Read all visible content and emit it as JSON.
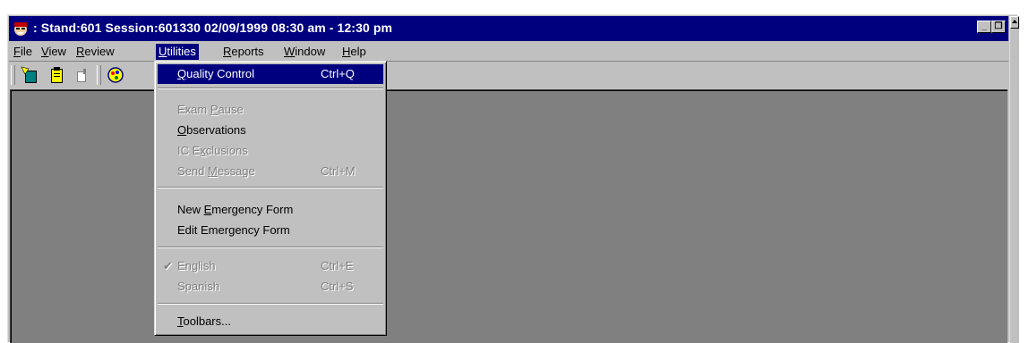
{
  "window": {
    "title": ": Stand:601 Session:601330 02/09/1999 08:30 am - 12:30 pm",
    "controls": {
      "minimize": "_",
      "restore": "❐"
    }
  },
  "menubar": [
    {
      "pre": "",
      "u": "F",
      "post": "ile"
    },
    {
      "pre": "",
      "u": "V",
      "post": "iew"
    },
    {
      "pre": "",
      "u": "R",
      "post": "eview"
    },
    {
      "pre": "",
      "u": "U",
      "post": "tilities"
    },
    {
      "pre": "",
      "u": "R",
      "post": "eports"
    },
    {
      "pre": "",
      "u": "W",
      "post": "indow"
    },
    {
      "pre": "",
      "u": "H",
      "post": "elp"
    }
  ],
  "toolbar": {
    "icons": [
      "new-exam-icon",
      "clipboard-icon",
      "exit-door-icon",
      "palette-icon"
    ]
  },
  "utilities_menu": {
    "items": [
      {
        "pre": "",
        "u": "Q",
        "post": "uality Control",
        "shortcut": "Ctrl+Q",
        "state": "selected"
      },
      {
        "pre": "Exam ",
        "u": "P",
        "post": "ause",
        "shortcut": "",
        "state": "disabled"
      },
      {
        "pre": "",
        "u": "O",
        "post": "bservations",
        "shortcut": "",
        "state": "enabled"
      },
      {
        "pre": "IC E",
        "u": "x",
        "post": "clusions",
        "shortcut": "",
        "state": "disabled"
      },
      {
        "pre": "Send ",
        "u": "M",
        "post": "essage",
        "shortcut": "Ctrl+M",
        "state": "disabled"
      },
      {
        "pre": "New ",
        "u": "E",
        "post": "mergency Form",
        "shortcut": "",
        "state": "enabled"
      },
      {
        "pre": "Edit Emer",
        "u": "g",
        "post": "ency Form",
        "shortcut": "",
        "state": "enabled"
      },
      {
        "pre": "English",
        "u": "",
        "post": "",
        "shortcut": "Ctrl+E",
        "state": "disabled",
        "checked": "✔"
      },
      {
        "pre": "Spanish",
        "u": "",
        "post": "",
        "shortcut": "Ctrl+S",
        "state": "disabled"
      },
      {
        "pre": "",
        "u": "T",
        "post": "oolbars...",
        "shortcut": "",
        "state": "enabled"
      }
    ]
  },
  "colors": {
    "titlebar": "#00007f",
    "face": "#c0c0c0",
    "workspace": "#808080",
    "highlight": "#00007f",
    "disabled_text": "#808080"
  }
}
